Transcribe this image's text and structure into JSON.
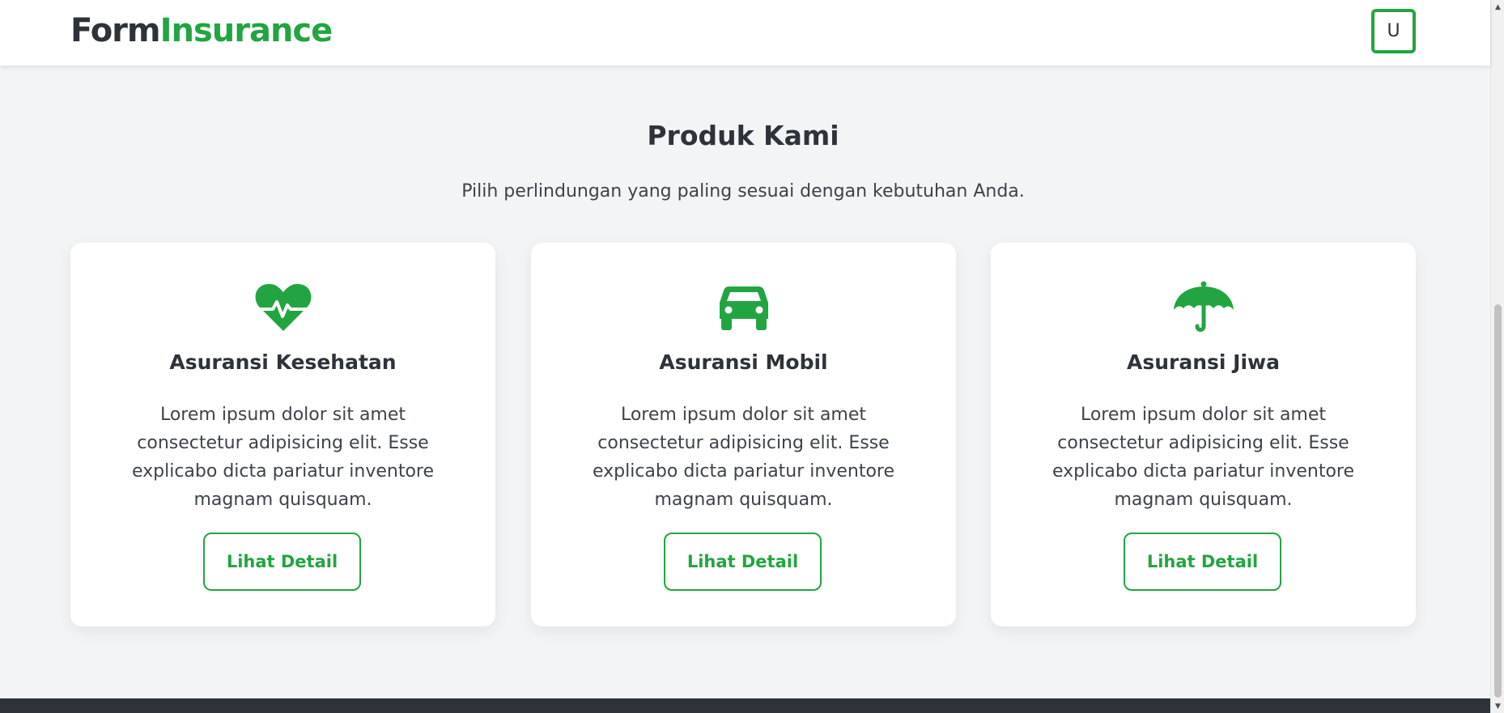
{
  "brand": {
    "part1": "Form",
    "part2": "Insurance"
  },
  "user_avatar": {
    "initial": "U"
  },
  "section": {
    "title": "Produk Kami",
    "subtitle": "Pilih perlindungan yang paling sesuai dengan kebutuhan Anda."
  },
  "products": [
    {
      "icon": "heart-pulse-icon",
      "title": "Asuransi Kesehatan",
      "description": "Lorem ipsum dolor sit amet consectetur adipisicing elit. Esse explicabo dicta pariatur inventore magnam quisquam.",
      "button_label": "Lihat Detail"
    },
    {
      "icon": "car-icon",
      "title": "Asuransi Mobil",
      "description": "Lorem ipsum dolor sit amet consectetur adipisicing elit. Esse explicabo dicta pariatur inventore magnam quisquam.",
      "button_label": "Lihat Detail"
    },
    {
      "icon": "umbrella-icon",
      "title": "Asuransi Jiwa",
      "description": "Lorem ipsum dolor sit amet consectetur adipisicing elit. Esse explicabo dicta pariatur inventore magnam quisquam.",
      "button_label": "Lihat Detail"
    }
  ],
  "colors": {
    "accent": "#22a541",
    "text_dark": "#2d3338",
    "background": "#f3f4f6",
    "footer": "#2d3338"
  }
}
